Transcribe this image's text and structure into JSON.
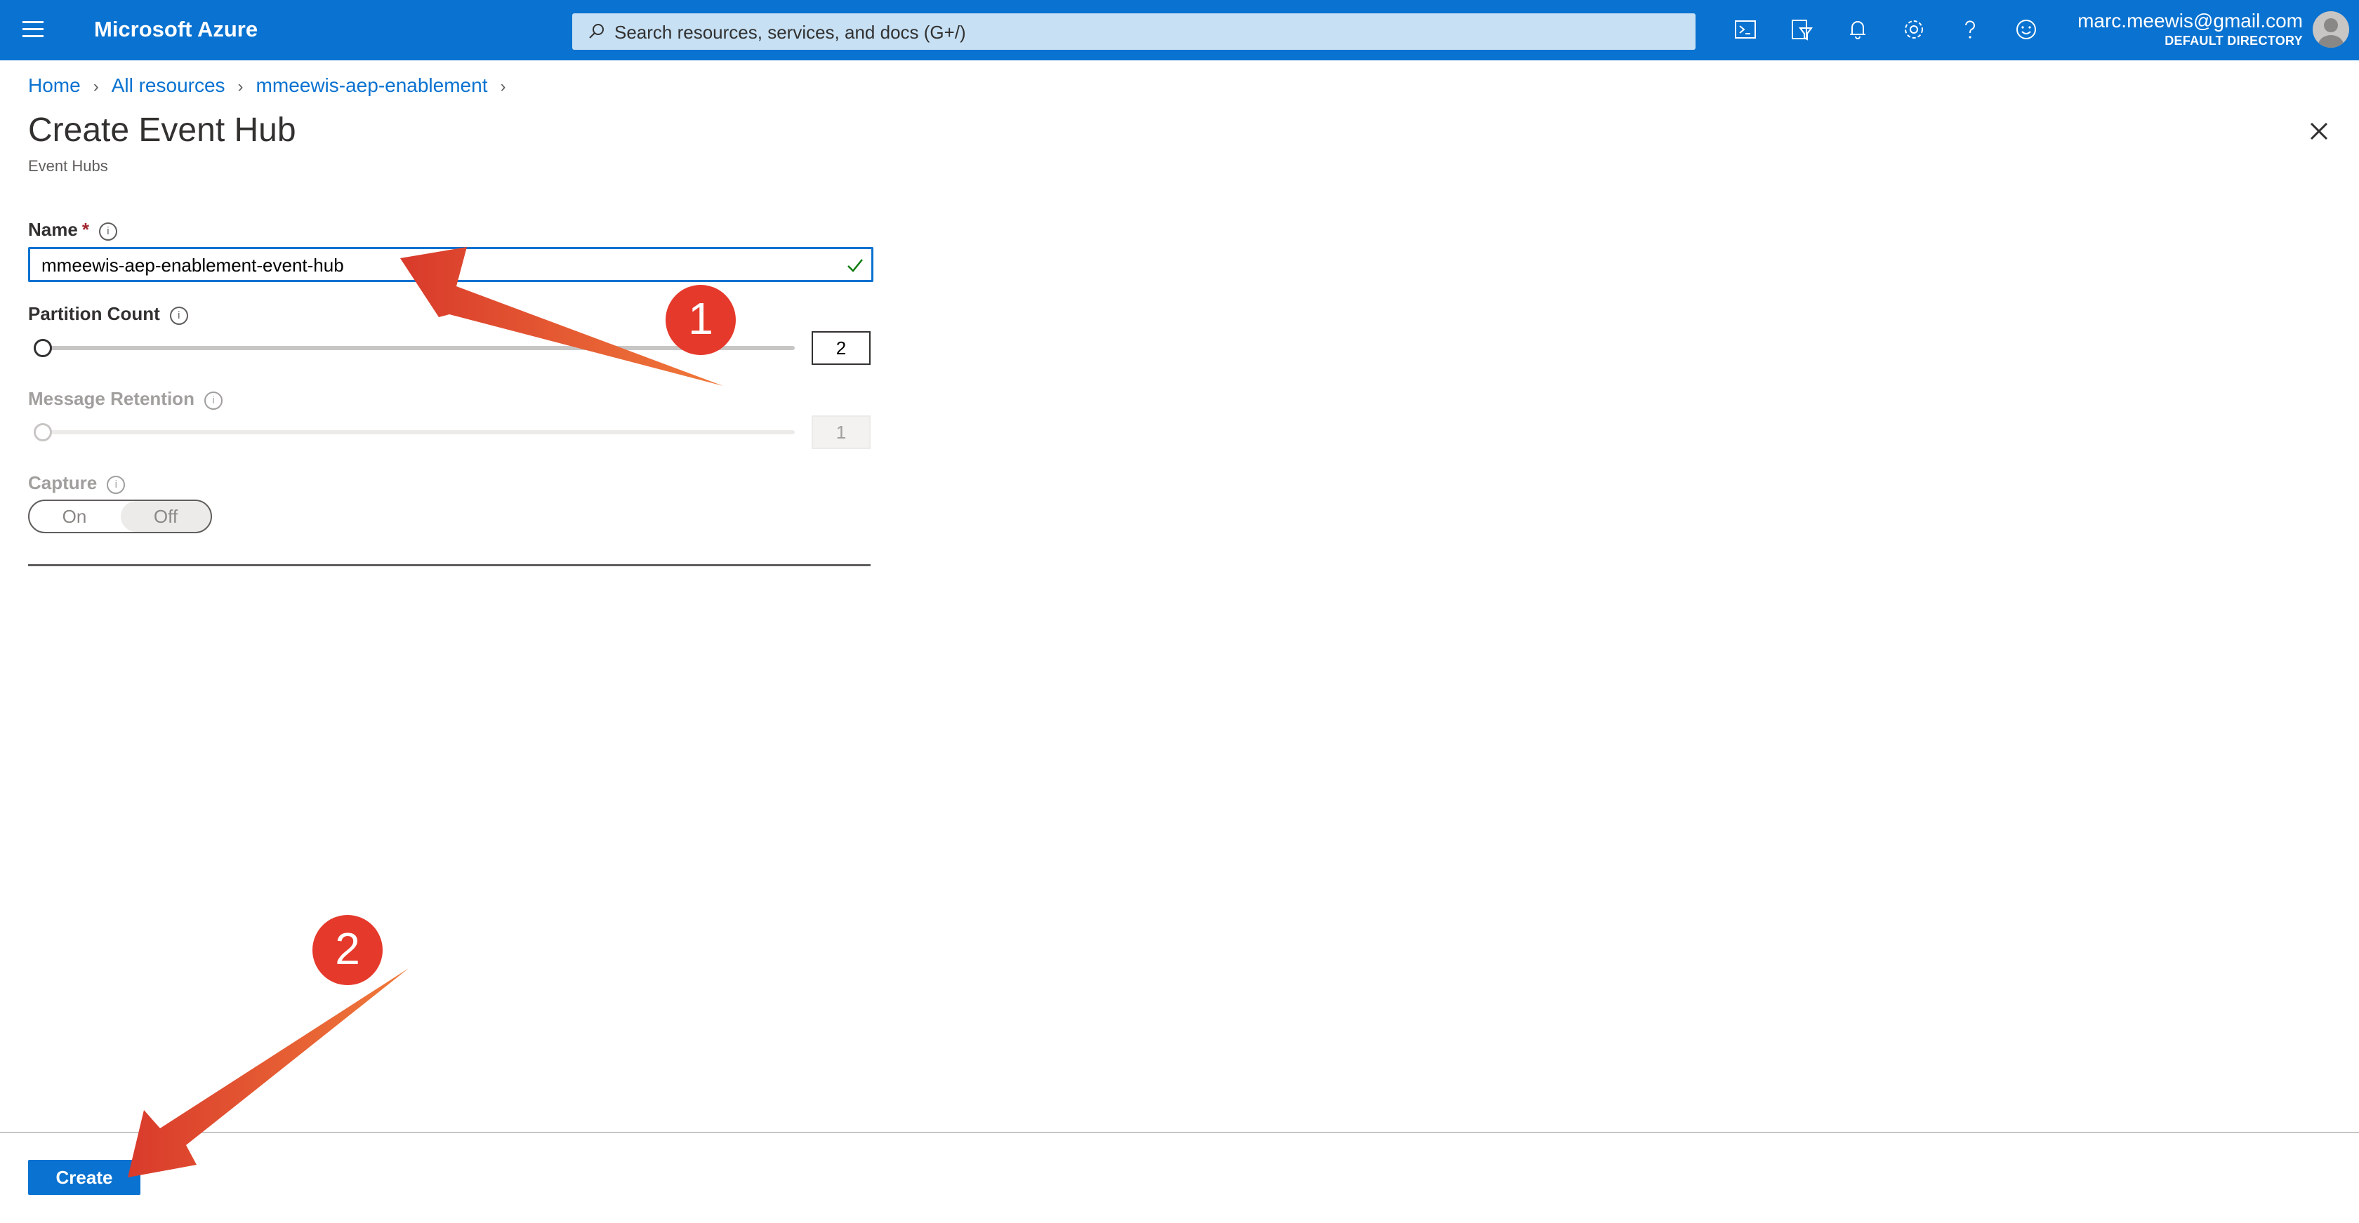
{
  "header": {
    "brand": "Microsoft Azure",
    "search_placeholder": "Search resources, services, and docs (G+/)",
    "account_email": "marc.meewis@gmail.com",
    "account_directory": "DEFAULT DIRECTORY",
    "accent_color": "#0a72d0",
    "icons": [
      "cloud-shell-icon",
      "directory-filter-icon",
      "notifications-icon",
      "settings-icon",
      "help-icon",
      "feedback-icon"
    ]
  },
  "breadcrumb": [
    "Home",
    "All resources",
    "mmeewis-aep-enablement"
  ],
  "page": {
    "title": "Create Event Hub",
    "subtitle": "Event Hubs"
  },
  "form": {
    "name_label": "Name",
    "required_mark": "*",
    "name_value": "mmeewis-aep-enablement-event-hub",
    "partition_label": "Partition Count",
    "partition_value": "2",
    "retention_label": "Message Retention",
    "retention_value": "1",
    "capture_label": "Capture",
    "capture_on": "On",
    "capture_off": "Off",
    "capture_selected": "Off"
  },
  "footer": {
    "create_label": "Create"
  },
  "annotations": {
    "step1": "1",
    "step2": "2"
  }
}
